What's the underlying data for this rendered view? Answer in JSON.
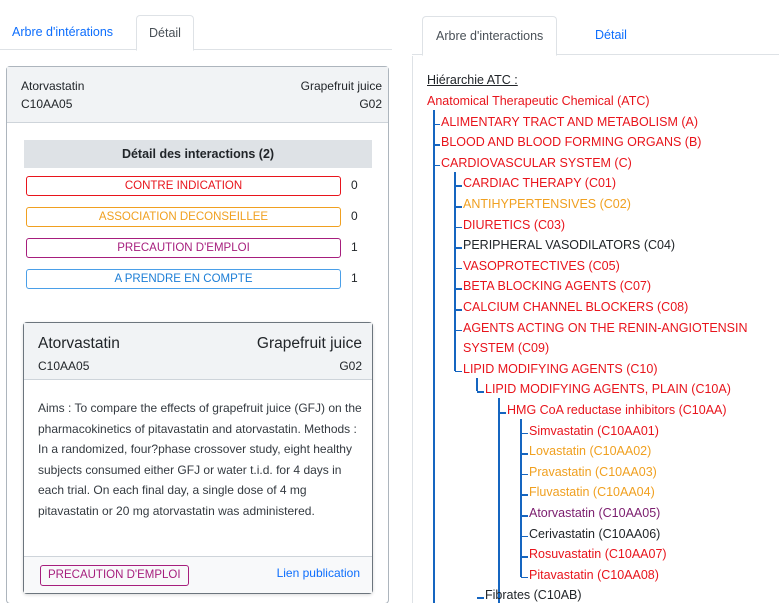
{
  "left": {
    "tabs": [
      {
        "label": "Arbre d'intérations"
      },
      {
        "label": "Détail"
      }
    ],
    "header": {
      "drug_a": "Atorvastatin",
      "code_a": "C10AA05",
      "drug_b": "Grapefruit juice",
      "code_b": "G02"
    },
    "detail_title": "Détail des interactions (2)",
    "interactions": [
      {
        "label": "CONTRE INDICATION",
        "count": "0",
        "color": "#e8141c"
      },
      {
        "label": "ASSOCIATION DECONSEILLEE",
        "count": "0",
        "color": "#f0a020"
      },
      {
        "label": "PRECAUTION D'EMPLOI",
        "count": "1",
        "color": "#a61e7d"
      },
      {
        "label": "A PRENDRE EN COMPTE",
        "count": "1",
        "color": "#4a9fe8"
      }
    ],
    "card": {
      "drug_a": "Atorvastatin",
      "code_a": "C10AA05",
      "drug_b": "Grapefruit juice",
      "code_b": "G02",
      "abstract": "Aims : To compare the effects of grapefruit juice (GFJ) on the pharmacokinetics of pitavastatin and atorvastatin. Methods : In a randomized, four?phase crossover study, eight healthy subjects consumed either GFJ or water t.i.d. for 4 days in each trial. On each final day, a single dose of 4 mg pitavastatin or 20 mg atorvastatin was administered.",
      "badge": "PRECAUTION D'EMPLOI",
      "link": "Lien publication"
    }
  },
  "right": {
    "tabs": [
      {
        "label": "Arbre d'interactions"
      },
      {
        "label": "Détail"
      }
    ],
    "hierarchy_label": "Hiérarchie ATC :",
    "tree": [
      {
        "label": "Anatomical Therapeutic Chemical (ATC)",
        "color": "red"
      },
      {
        "label": "ALIMENTARY TRACT AND METABOLISM (A)",
        "color": "red"
      },
      {
        "label": "BLOOD AND BLOOD FORMING ORGANS (B)",
        "color": "red"
      },
      {
        "label": "CARDIOVASCULAR SYSTEM (C)",
        "color": "red"
      },
      {
        "label": "CARDIAC THERAPY (C01)",
        "color": "red"
      },
      {
        "label": "ANTIHYPERTENSIVES (C02)",
        "color": "orange"
      },
      {
        "label": "DIURETICS (C03)",
        "color": "red"
      },
      {
        "label": "PERIPHERAL VASODILATORS (C04)",
        "color": "black"
      },
      {
        "label": "VASOPROTECTIVES (C05)",
        "color": "red"
      },
      {
        "label": "BETA BLOCKING AGENTS (C07)",
        "color": "red"
      },
      {
        "label": "CALCIUM CHANNEL BLOCKERS (C08)",
        "color": "red"
      },
      {
        "label": "AGENTS ACTING ON THE RENIN-ANGIOTENSIN",
        "color": "red"
      },
      {
        "label": "SYSTEM (C09)",
        "color": "red"
      },
      {
        "label": "LIPID MODIFYING AGENTS (C10)",
        "color": "red"
      },
      {
        "label": "LIPID MODIFYING AGENTS, PLAIN (C10A)",
        "color": "red"
      },
      {
        "label": "HMG CoA reductase inhibitors (C10AA)",
        "color": "red"
      },
      {
        "label": "Simvastatin (C10AA01)",
        "color": "red"
      },
      {
        "label": "Lovastatin (C10AA02)",
        "color": "orange"
      },
      {
        "label": "Pravastatin (C10AA03)",
        "color": "orange"
      },
      {
        "label": "Fluvastatin (C10AA04)",
        "color": "orange"
      },
      {
        "label": "Atorvastatin (C10AA05)",
        "color": "purple"
      },
      {
        "label": "Cerivastatin (C10AA06)",
        "color": "black"
      },
      {
        "label": "Rosuvastatin (C10AA07)",
        "color": "red"
      },
      {
        "label": "Pitavastatin (C10AA08)",
        "color": "red"
      },
      {
        "label": "Fibrates (C10AB)",
        "color": "black"
      }
    ]
  }
}
